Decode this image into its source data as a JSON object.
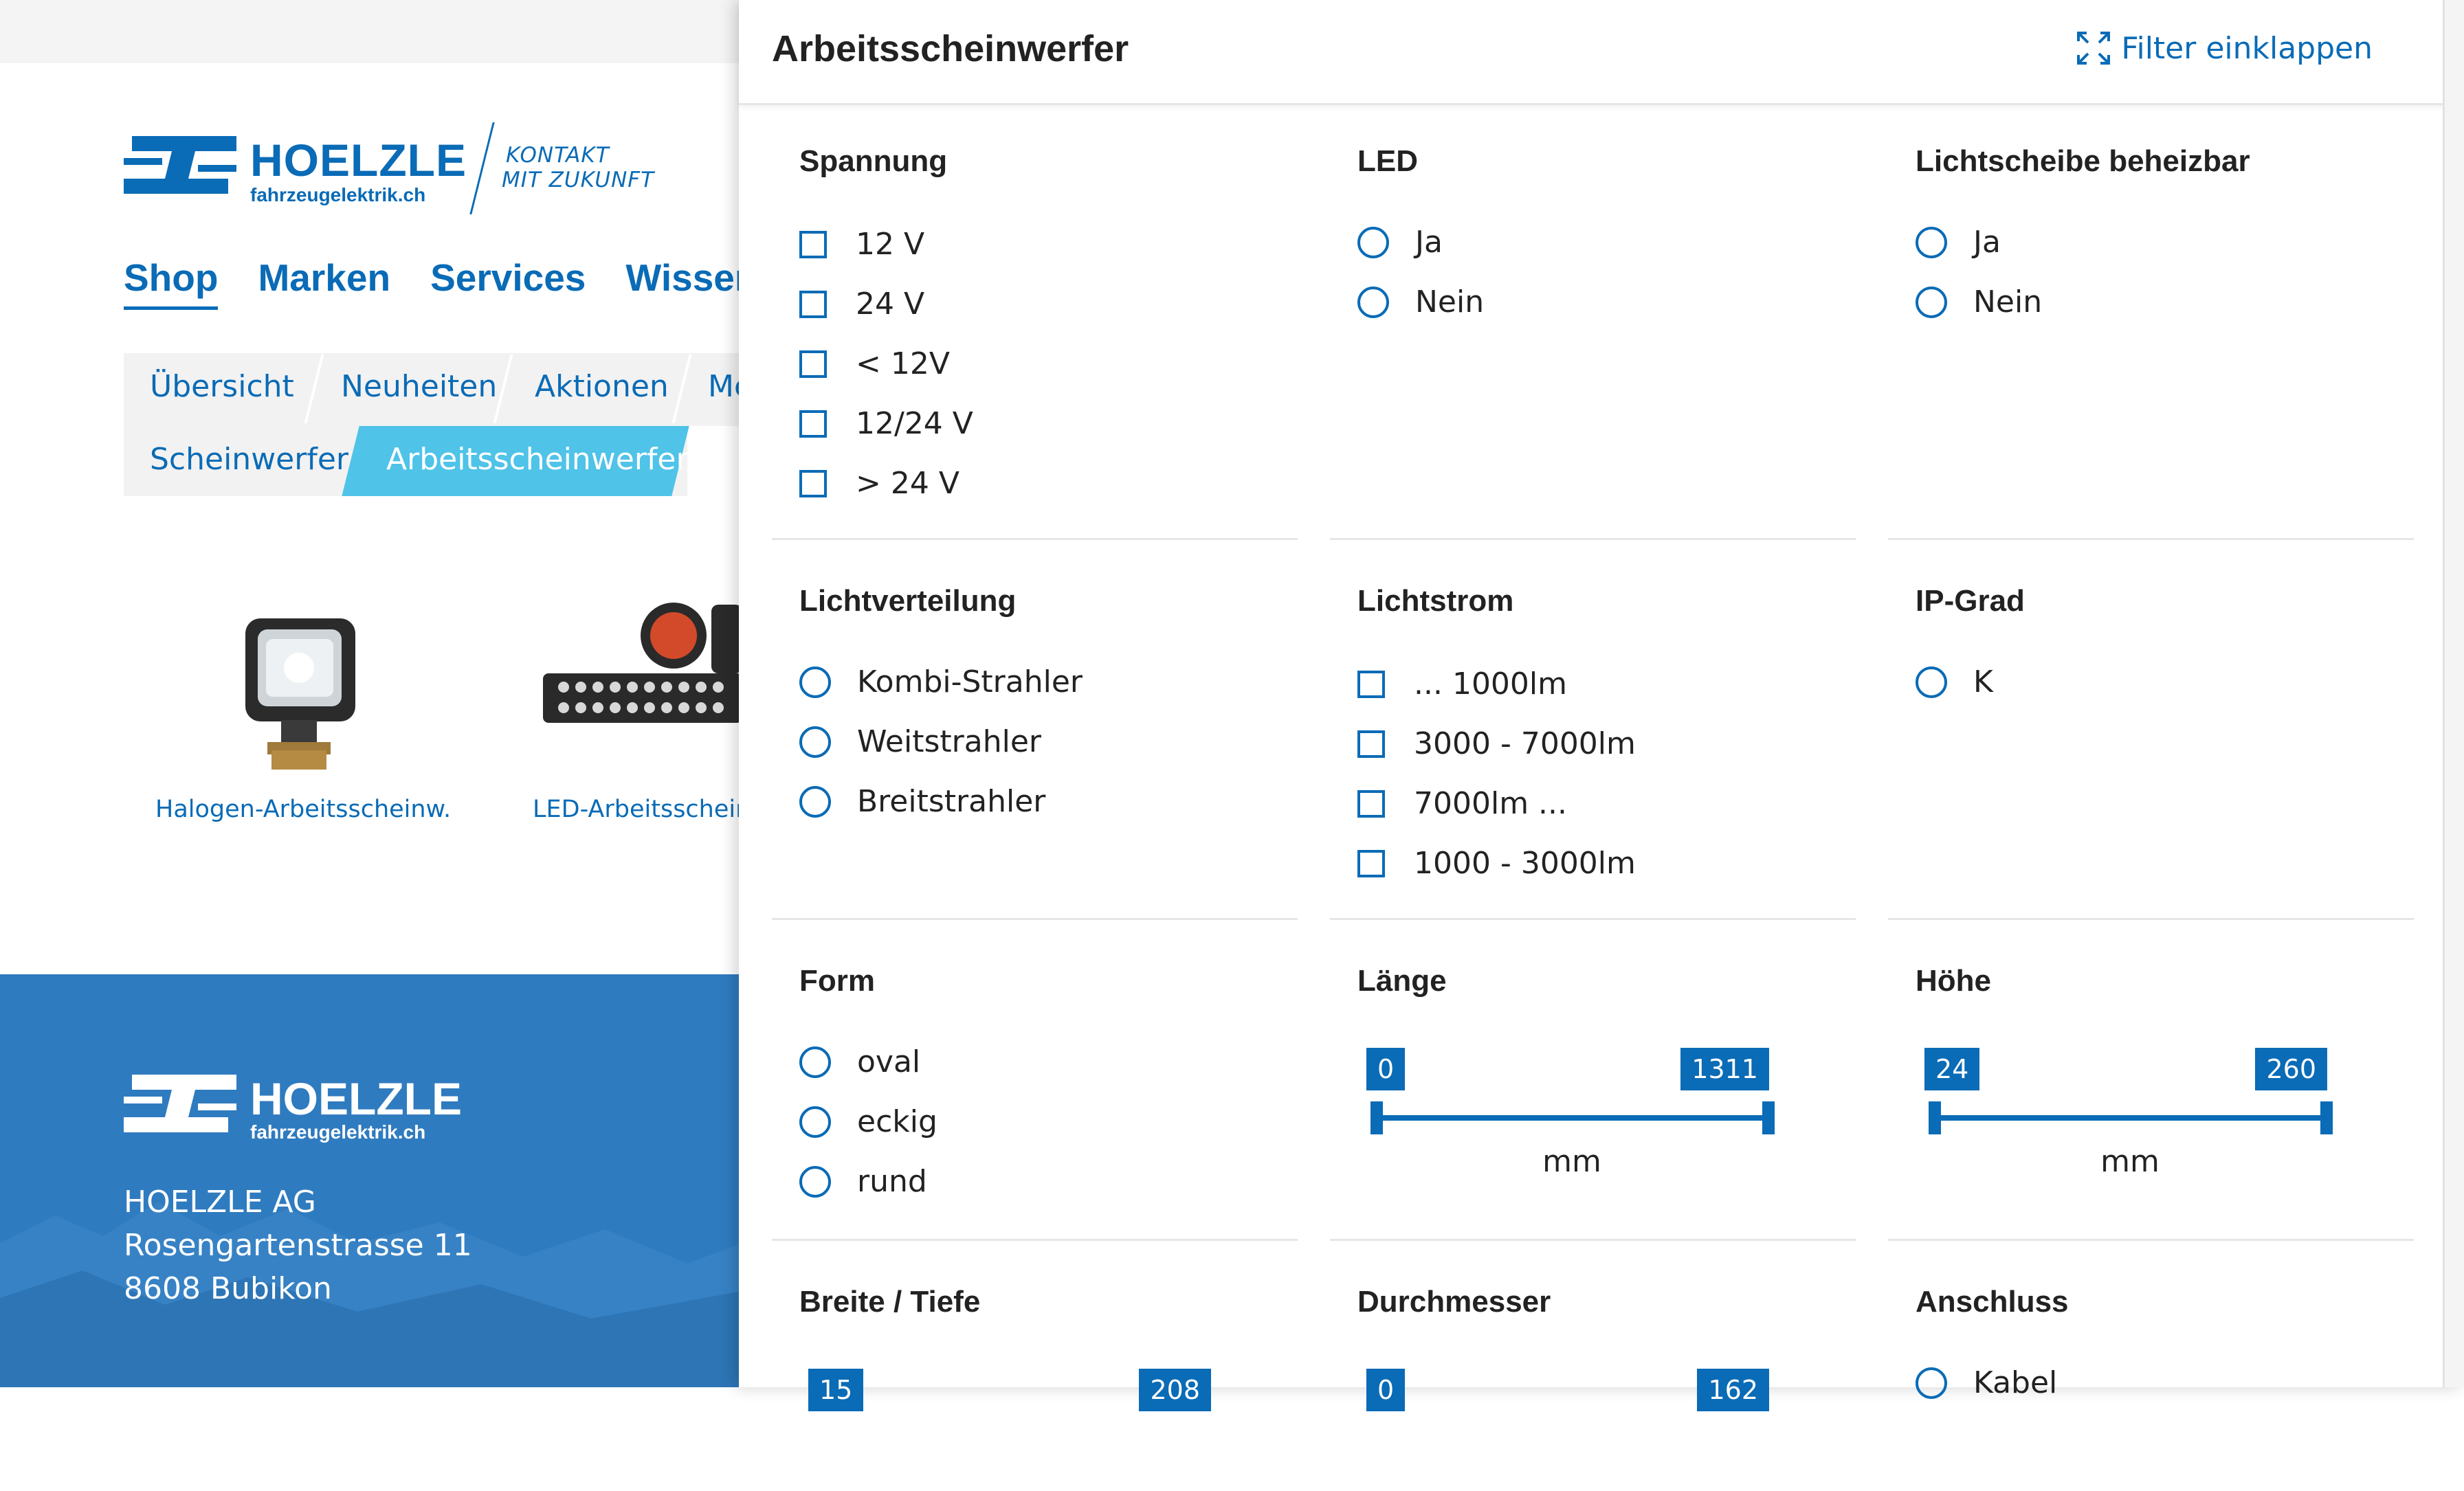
{
  "site": {
    "brand": "HOELZLE",
    "domain": "fahrzeugelektrik.ch",
    "slogan": [
      "KONTAKT",
      "MIT ZUKUNFT"
    ],
    "main_nav": [
      "Shop",
      "Marken",
      "Services",
      "Wissen"
    ],
    "sub_nav_row1": [
      "Übersicht",
      "Neuheiten",
      "Aktionen",
      "Me"
    ],
    "sub_nav_row2": [
      "Scheinwerfer",
      "Arbeitsscheinwerfer"
    ],
    "products": [
      "Halogen-Arbeitsscheinw.",
      "LED-Arbeitsscheinw"
    ],
    "footer_brand": "HOELZLE",
    "footer_domain": "fahrzeugelektrik.ch",
    "address": [
      "HOELZLE AG",
      "Rosengartenstrasse 11",
      "8608 Bubikon"
    ]
  },
  "filter": {
    "title": "Arbeitsscheinwerfer",
    "collapse_label": "Filter einklappen",
    "sections": {
      "spannung": {
        "title": "Spannung",
        "options": [
          "12 V",
          "24 V",
          "< 12V",
          "12/24 V",
          "> 24 V"
        ]
      },
      "led": {
        "title": "LED",
        "options": [
          "Ja",
          "Nein"
        ]
      },
      "lichtscheibe": {
        "title": "Lichtscheibe beheizbar",
        "options": [
          "Ja",
          "Nein"
        ]
      },
      "lichtverteilung": {
        "title": "Lichtverteilung",
        "options": [
          "Kombi-Strahler",
          "Weitstrahler",
          "Breitstrahler"
        ]
      },
      "lichtstrom": {
        "title": "Lichtstrom",
        "options": [
          "... 1000lm",
          "3000 - 7000lm",
          "7000lm ...",
          "1000 - 3000lm"
        ]
      },
      "ipgrad": {
        "title": "IP-Grad",
        "options": [
          "K"
        ]
      },
      "form": {
        "title": "Form",
        "options": [
          "oval",
          "eckig",
          "rund"
        ]
      },
      "laenge": {
        "title": "Länge",
        "min": "0",
        "max": "1311",
        "unit": "mm"
      },
      "hoehe": {
        "title": "Höhe",
        "min": "24",
        "max": "260",
        "unit": "mm"
      },
      "breite": {
        "title": "Breite / Tiefe",
        "min": "15",
        "max": "208"
      },
      "durchmesser": {
        "title": "Durchmesser",
        "min": "0",
        "max": "162"
      },
      "anschluss": {
        "title": "Anschluss",
        "options": [
          "Kabel"
        ]
      }
    }
  },
  "colors": {
    "primary": "#0a6bb6",
    "active_tab": "#4fc3e8",
    "footer": "#2f7bbf"
  }
}
